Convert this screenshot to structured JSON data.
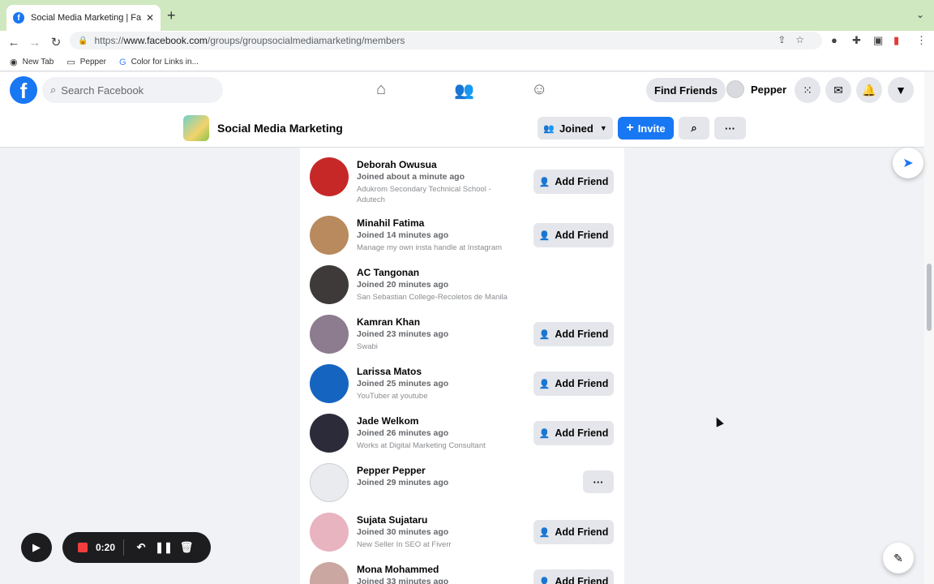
{
  "browser": {
    "tab_title": "Social Media Marketing | Faceb",
    "url_prefix": "https://",
    "url_host": "www.facebook.com",
    "url_path": "/groups/groupsocialmediamarketing/members",
    "bookmarks": [
      "New Tab",
      "Pepper",
      "Color for Links in..."
    ]
  },
  "fb": {
    "search_placeholder": "Search Facebook",
    "find_friends": "Find Friends",
    "profile_name": "Pepper"
  },
  "group": {
    "name": "Social Media Marketing",
    "joined_label": "Joined",
    "invite_label": "Invite"
  },
  "add_friend_label": "Add Friend",
  "members": [
    {
      "name": "Deborah Owusua",
      "joined": "Joined about a minute ago",
      "info": "Adukrom Secondary Technical School - Adutech",
      "action": "add",
      "color": "#c62828"
    },
    {
      "name": "Minahil Fatima",
      "joined": "Joined 14 minutes ago",
      "info": "Manage my own insta handle at Instagram",
      "action": "add",
      "color": "#b98a5e"
    },
    {
      "name": "AC Tangonan",
      "joined": "Joined 20 minutes ago",
      "info": "San Sebastian College-Recoletos de Manila",
      "action": "none",
      "color": "#3e3a3a"
    },
    {
      "name": "Kamran Khan",
      "joined": "Joined 23 minutes ago",
      "info": "Swabi",
      "action": "add",
      "color": "#8d7b8f"
    },
    {
      "name": "Larissa Matos",
      "joined": "Joined 25 minutes ago",
      "info": "YouTuber at youtube",
      "action": "add",
      "color": "#1565c0"
    },
    {
      "name": "Jade Welkom",
      "joined": "Joined 26 minutes ago",
      "info": "Works at Digital Marketing Consultant",
      "action": "add",
      "color": "#2b2b3a"
    },
    {
      "name": "Pepper Pepper",
      "joined": "Joined 29 minutes ago",
      "info": "",
      "action": "more",
      "color": "#e9ebee"
    },
    {
      "name": "Sujata Sujataru",
      "joined": "Joined 30 minutes ago",
      "info": "New Seller In SEO at Fiverr",
      "action": "add",
      "color": "#e8b4c0"
    },
    {
      "name": "Mona Mohammed",
      "joined": "Joined 33 minutes ago",
      "info": "",
      "action": "add",
      "color": "#caa7a0"
    }
  ],
  "recorder": {
    "time": "0:20"
  },
  "colors": {
    "brand": "#1877f2",
    "record": "#f03e3e"
  }
}
